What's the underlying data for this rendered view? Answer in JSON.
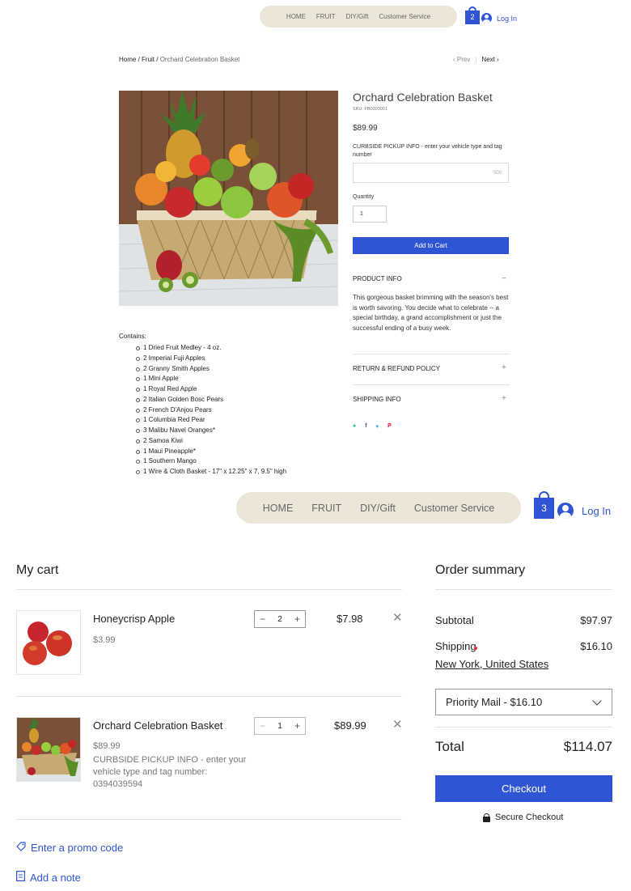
{
  "top_nav": {
    "items": [
      "HOME",
      "FRUIT",
      "DIY/Gift",
      "Customer Service"
    ],
    "cart_count": "2",
    "login_label": "Log In"
  },
  "breadcrumb": {
    "home": "Home",
    "sep1": " / ",
    "fruit": "Fruit",
    "sep2": " / ",
    "current": "Orchard Celebration Basket"
  },
  "pager": {
    "prev": "Prev",
    "next": "Next"
  },
  "product": {
    "title": "Orchard Celebration Basket",
    "sku": "SKU: FB0000001",
    "price": "$89.99",
    "curbside_label": "CURBSIDE PICKUP INFO - enter your vehicle type and tag number",
    "char_limit": "500",
    "quantity_label": "Quantity",
    "quantity_value": "1",
    "add_to_cart": "Add to Cart",
    "product_info_title": "PRODUCT INFO",
    "product_info_text": "This gorgeous basket brimming with the season's best is worth savoring. You decide what to celebrate -- a special birthday, a grand accomplishment or just the successful ending of a busy week.",
    "return_title": "RETURN & REFUND POLICY",
    "shipping_title": "SHIPPING INFO",
    "contains_label": "Contains:",
    "contents": [
      "1 Dried Fruit Medley - 4 oz.",
      "2 Imperial Fuji Apples",
      "2 Granny Smith Apples",
      "1 Mini Apple",
      "1 Royal Red Apple",
      "2 Italian Golden Bosc Pears",
      "2 French D'Anjou Pears",
      "1 Columbia Red Pear",
      "3 Malibu Navel Oranges*",
      "2 Samoa Kiwi",
      "1 Maui Pineapple*",
      "1 Southern Mango",
      "1 Wire & Cloth Basket - 17\" x 12.25\" x 7, 9.5\" high"
    ]
  },
  "social": {
    "whatsapp_color": "#25d366",
    "facebook_color": "#3b5998",
    "twitter_color": "#1da1f2",
    "pinterest_color": "#e60023"
  },
  "second_nav": {
    "items": [
      "HOME",
      "FRUIT",
      "DIY/Gift",
      "Customer Service"
    ],
    "cart_count": "3",
    "login_label": "Log In"
  },
  "cart": {
    "title": "My cart",
    "items": [
      {
        "name": "Honeycrisp Apple",
        "unit_price": "$3.99",
        "quantity": "2",
        "total": "$7.98"
      },
      {
        "name": "Orchard Celebration Basket",
        "unit_price": "$89.99",
        "note": "CURBSIDE PICKUP INFO - enter your vehicle type and tag number: 0394039594",
        "quantity": "1",
        "total": "$89.99"
      }
    ],
    "promo_label": "Enter a promo code",
    "note_label": "Add a note"
  },
  "summary": {
    "title": "Order summary",
    "subtotal_label": "Subtotal",
    "subtotal_value": "$97.97",
    "shipping_label": "Shipping",
    "shipping_value": "$16.10",
    "location": "New York, United States",
    "shipping_method": "Priority Mail - $16.10",
    "total_label": "Total",
    "total_value": "$114.07",
    "checkout_label": "Checkout",
    "secure_label": "Secure Checkout"
  },
  "colors": {
    "accent": "#2f55d4",
    "nav_bg": "#ece6d9"
  }
}
